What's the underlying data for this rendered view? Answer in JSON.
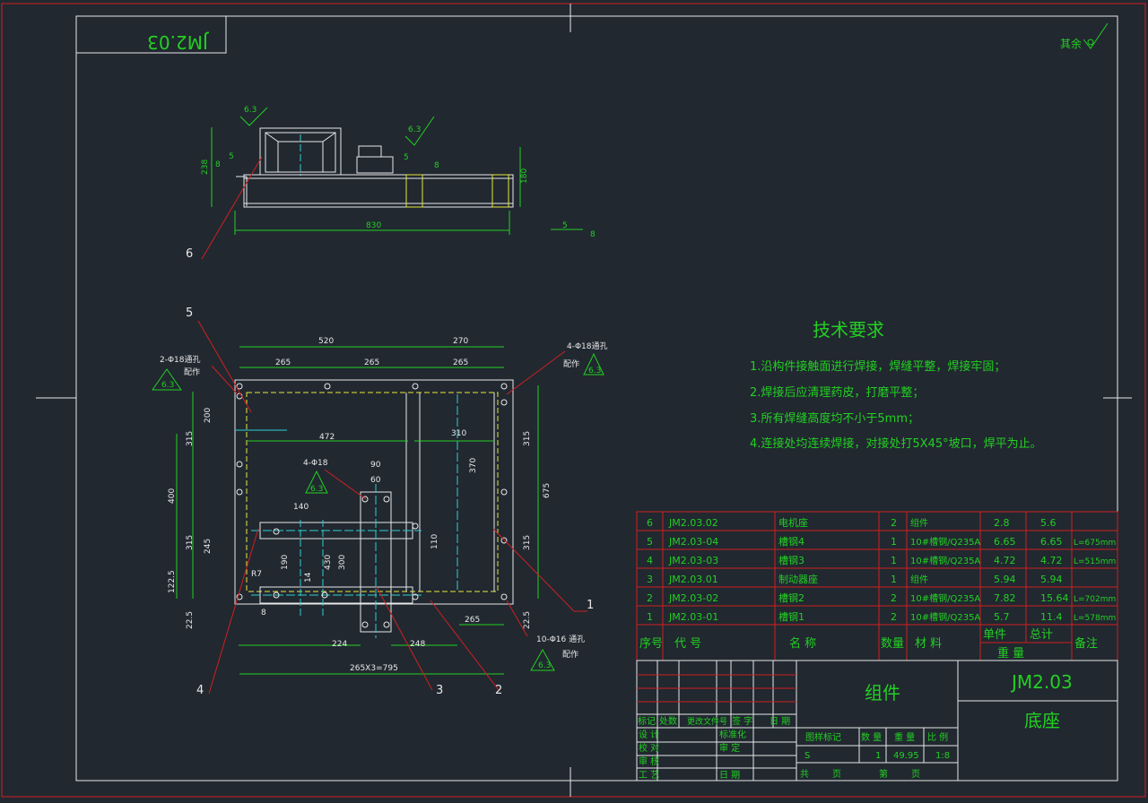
{
  "title_box": {
    "mirrored_code": "JM2.03"
  },
  "roughness_corner": "其余",
  "roughness_marks": [
    "6.3",
    "6.3",
    "6.3",
    "6.3",
    "6.3",
    "6.3"
  ],
  "top_view": {
    "dims": [
      "238",
      "180",
      "830"
    ],
    "weld_marks": [
      "5",
      "8",
      "5",
      "8",
      "5",
      "8"
    ],
    "callout": "6"
  },
  "plan_view": {
    "dims_top": [
      "520",
      "270",
      "265",
      "265",
      "265"
    ],
    "dims_inner": [
      "472",
      "310",
      "370",
      "90",
      "60",
      "140",
      "110",
      "190",
      "14",
      "430",
      "300",
      "R7",
      "8",
      "224",
      "248",
      "265",
      "265X3=795"
    ],
    "dims_left": [
      "200",
      "315",
      "400",
      "315",
      "245",
      "122.5",
      "22.5"
    ],
    "dims_right": [
      "315",
      "675",
      "315",
      "22.5"
    ],
    "hole_notes": [
      "2-Φ18通孔",
      "配作",
      "4-Φ18通孔",
      "配作",
      "4-Φ18",
      "10-Φ16 通孔",
      "配作"
    ],
    "callouts": [
      "5",
      "1",
      "4",
      "3",
      "2"
    ]
  },
  "tech_req": {
    "title": "技术要求",
    "items": [
      "1.沿构件接触面进行焊接，焊缝平整，焊接牢固；",
      "2.焊接后应清理药皮，打磨平整；",
      "3.所有焊缝高度均不小于5mm；",
      "4.连接处均连续焊接，对接处打5X45°坡口，焊平为止。"
    ]
  },
  "bom": {
    "rows": [
      [
        "6",
        "JM2.03.02",
        "电机座",
        "2",
        "组件",
        "2.8",
        "5.6",
        ""
      ],
      [
        "5",
        "JM2.03-04",
        "槽钢4",
        "1",
        "10#槽钢/Q235A",
        "6.65",
        "6.65",
        "L=675mm"
      ],
      [
        "4",
        "JM2.03-03",
        "槽钢3",
        "1",
        "10#槽钢/Q235A",
        "4.72",
        "4.72",
        "L=515mm"
      ],
      [
        "3",
        "JM2.03.01",
        "制动器座",
        "1",
        "组件",
        "5.94",
        "5.94",
        ""
      ],
      [
        "2",
        "JM2.03-02",
        "槽钢2",
        "2",
        "10#槽钢/Q235A",
        "7.82",
        "15.64",
        "L=702mm"
      ],
      [
        "1",
        "JM2.03-01",
        "槽钢1",
        "2",
        "10#槽钢/Q235A",
        "5.7",
        "11.4",
        "L=578mm"
      ]
    ],
    "header": [
      "序号",
      "代  号",
      "名  称",
      "数量",
      "材  料",
      "单件",
      "总计",
      "重  量",
      "备注"
    ]
  },
  "title_block": {
    "name": "组件",
    "code": "JM2.03",
    "part": "底座",
    "rev_labels": [
      "标记",
      "处数",
      "更改文件号",
      "签 字",
      "日 期"
    ],
    "sign_labels": [
      "设 计",
      "标准化",
      "校 对",
      "审 定",
      "审 核",
      "工 艺",
      "日 期"
    ],
    "meta_labels": [
      "图样标记",
      "数 量",
      "重 量",
      "比 例"
    ],
    "meta_values": [
      "S",
      "1",
      "49.95",
      "1:8"
    ],
    "sheet_labels": [
      "共",
      "页",
      "第",
      "页"
    ]
  }
}
